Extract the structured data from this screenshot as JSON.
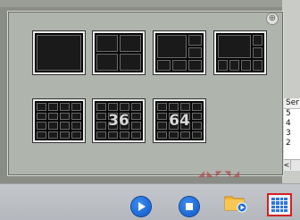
{
  "overlay": {
    "pin_icon": "pin-icon",
    "layouts": [
      {
        "id": "1",
        "cols": 1,
        "rows": 1,
        "label": ""
      },
      {
        "id": "4",
        "cols": 2,
        "rows": 2,
        "label": ""
      },
      {
        "id": "6",
        "cols": 3,
        "rows": 3,
        "label": ""
      },
      {
        "id": "8",
        "cols": 4,
        "rows": 3,
        "label": ""
      },
      {
        "id": "16",
        "cols": 4,
        "rows": 4,
        "label": ""
      },
      {
        "id": "36",
        "cols": 4,
        "rows": 4,
        "label": "36"
      },
      {
        "id": "64",
        "cols": 4,
        "rows": 4,
        "label": "64"
      }
    ]
  },
  "side_list": {
    "header": "Ser",
    "rows": [
      "5",
      "4",
      "3",
      "2"
    ],
    "scroll_left": "<"
  },
  "taskbar": {
    "buttons": [
      "play-icon",
      "stop-icon",
      "folder-playback-icon",
      "grid-layout-icon"
    ]
  },
  "colors": {
    "accent_blue": "#1565d8",
    "highlight_red": "#d32222",
    "panel_bg": "#bec4bc"
  }
}
